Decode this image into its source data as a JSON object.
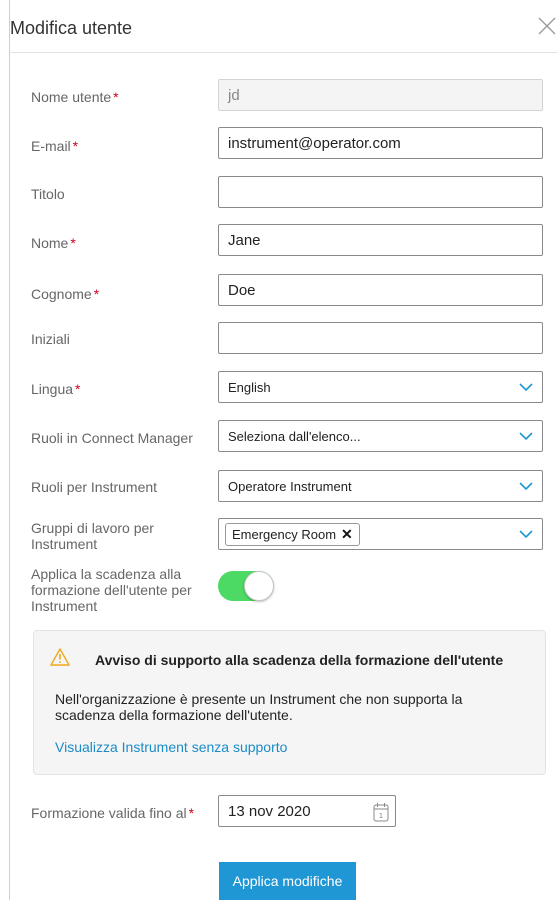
{
  "dialog": {
    "title": "Modifica utente",
    "close_icon": "close-icon"
  },
  "required_marker": "*",
  "fields": {
    "username": {
      "label": "Nome utente",
      "value": "jd"
    },
    "email": {
      "label": "E-mail",
      "value": "instrument@operator.com"
    },
    "titolo": {
      "label": "Titolo",
      "value": ""
    },
    "nome": {
      "label": "Nome",
      "value": "Jane"
    },
    "cognome": {
      "label": "Cognome",
      "value": "Doe"
    },
    "iniziali": {
      "label": "Iniziali",
      "value": ""
    },
    "lingua": {
      "label": "Lingua",
      "value": "English"
    },
    "ruoli_cm": {
      "label": "Ruoli in Connect Manager",
      "value": "Seleziona dall'elenco..."
    },
    "ruoli_instr": {
      "label": "Ruoli per Instrument",
      "value": "Operatore Instrument"
    },
    "gruppi": {
      "label_line1": "Gruppi di lavoro per",
      "label_line2": "Instrument",
      "tags": [
        "Emergency Room"
      ],
      "tag_remove": "✕"
    },
    "scadenza_toggle": {
      "label_line1": "Applica la scadenza alla",
      "label_line2": "formazione dell'utente per",
      "label_line3": "Instrument",
      "on": true
    }
  },
  "notice": {
    "title": "Avviso di supporto alla scadenza della formazione dell'utente",
    "body": "Nell'organizzazione è presente un Instrument che non supporta la scadenza della formazione dell'utente.",
    "link": "Visualizza Instrument senza supporto",
    "icon": "warning-icon"
  },
  "formazione": {
    "label": "Formazione valida fino al",
    "value": "13 nov 2020",
    "icon": "calendar-icon"
  },
  "apply_button": "Applica modifiche",
  "colors": {
    "accent": "#1f97d4",
    "required": "#d0021b",
    "toggle_on": "#4cd964",
    "link": "#1a8bc7"
  }
}
